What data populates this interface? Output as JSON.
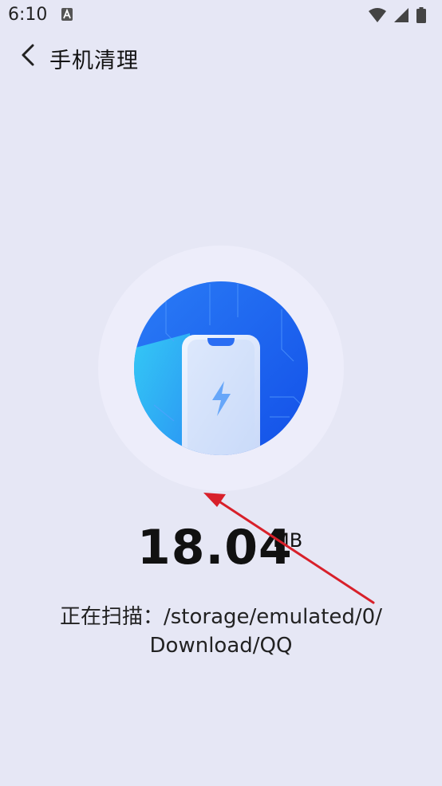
{
  "status_bar": {
    "time": "6:10",
    "notification_icon": "android-a-icon",
    "wifi_icon": "wifi-icon",
    "signal_icon": "cell-signal-icon",
    "battery_icon": "battery-icon"
  },
  "header": {
    "back_icon": "chevron-left-icon",
    "title": "手机清理"
  },
  "illustration": {
    "icon": "phone-cleaning-icon",
    "accent": "#1f6bf2",
    "ring_color": "#ededfa"
  },
  "scan": {
    "size_value": "18.04",
    "size_unit": "MB",
    "label": "正在扫描：/storage/emulated/0/",
    "path_line2": "Download/QQ"
  },
  "annotation": {
    "arrow_color": "#d8202a"
  }
}
